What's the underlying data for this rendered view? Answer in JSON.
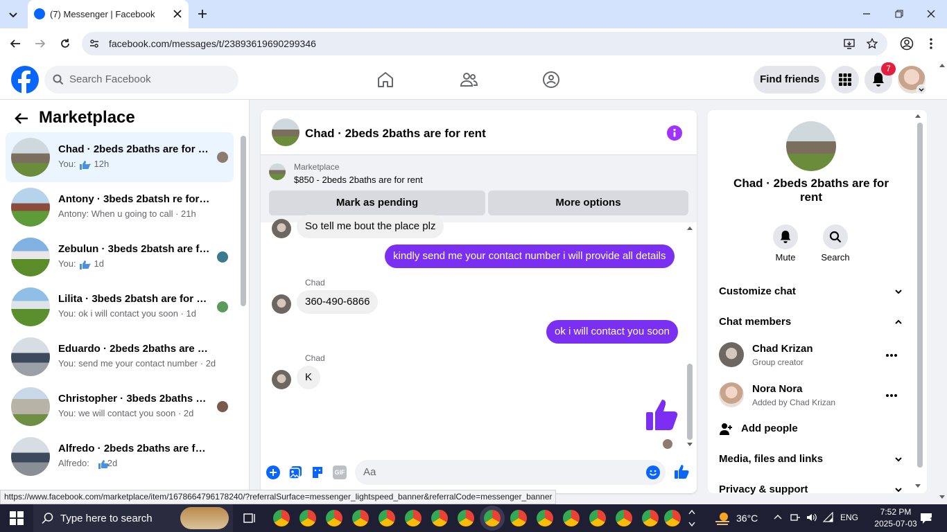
{
  "browser": {
    "tab_title": "(7) Messenger | Facebook",
    "url": "facebook.com/messages/t/23893619690299346"
  },
  "header": {
    "search_placeholder": "Search Facebook",
    "find_friends": "Find friends",
    "notif_count": "7"
  },
  "sidebar": {
    "title": "Marketplace",
    "conversations": [
      {
        "title": "Chad · 2beds 2baths are for re...",
        "sub": "You:     · 12h"
      },
      {
        "title": "Antony · 3beds 2batsh re for rent",
        "sub": "Antony: When u going to call · 21h"
      },
      {
        "title": "Zebulun · 3beds 2batsh are fo...",
        "sub": "You:     · 1d"
      },
      {
        "title": "Lilita · 3beds 2batsh are for rent",
        "sub": "You: ok i will contact you soon · 1d"
      },
      {
        "title": "Eduardo · 2beds 2baths are for r...",
        "sub": "You: send me your contact number · 2d"
      },
      {
        "title": "Christopher · 3beds 2baths ar...",
        "sub": "You: we will contact you soon · 2d"
      },
      {
        "title": "Alfredo · 2beds 2baths are for re...",
        "sub": "Alfredo:     · 2d"
      }
    ]
  },
  "chat": {
    "title": "Chad · 2beds 2baths are for rent",
    "listing_source": "Marketplace",
    "listing_title": "$850 - 2beds 2baths are for rent",
    "mark_pending": "Mark as pending",
    "more_options": "More options",
    "messages": {
      "m1": "So tell me bout the place plz",
      "m2": "kindly send me your contact number i will provide all  details",
      "sender1": "Chad",
      "m3": "360-490-6866",
      "m4": "ok i will contact you soon",
      "sender2": "Chad",
      "m5": "K"
    },
    "composer_placeholder": "Aa"
  },
  "details": {
    "name": "Chad · 2beds 2baths are for rent",
    "mute": "Mute",
    "search": "Search",
    "customize": "Customize chat",
    "members_heading": "Chat members",
    "members": [
      {
        "name": "Chad Krizan",
        "role": "Group creator"
      },
      {
        "name": "Nora Nora",
        "role": "Added by Chad Krizan"
      }
    ],
    "add_people": "Add people",
    "media": "Media, files and links",
    "privacy": "Privacy & support"
  },
  "status_url": "https://www.facebook.com/marketplace/item/1678664796178240/?referralSurface=messenger_lightspeed_banner&referralCode=messenger_banner",
  "taskbar": {
    "search_placeholder": "Type here to search",
    "temperature": "36°C",
    "lang": "ENG",
    "time": "7:52 PM",
    "date": "2025-07-03",
    "notif": "1"
  },
  "colors": {
    "fb_blue": "#0866ff",
    "accent_purple": "#7b2ff2"
  }
}
